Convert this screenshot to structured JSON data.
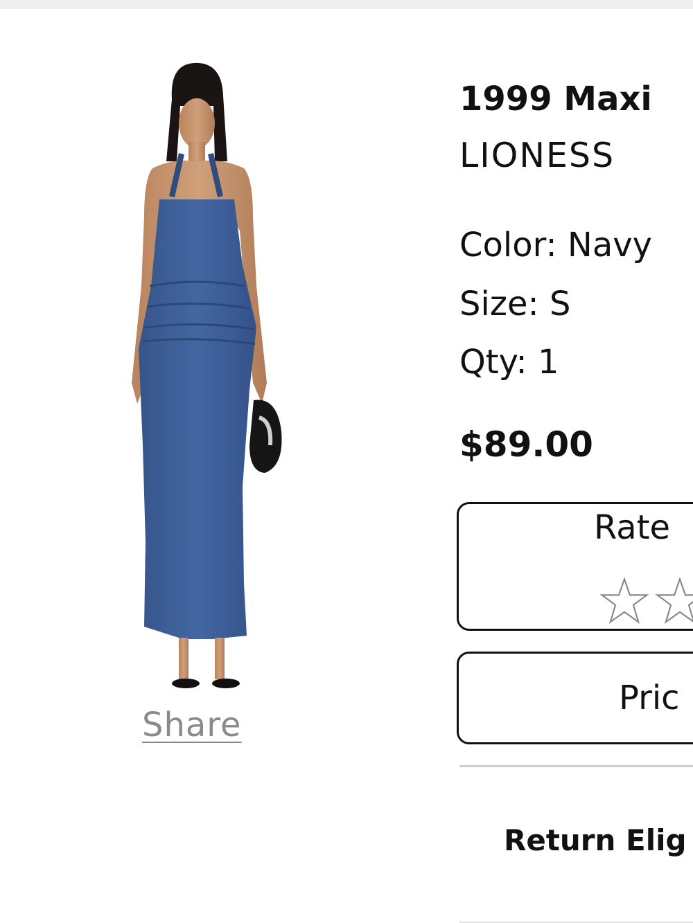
{
  "product": {
    "title": "1999 Maxi",
    "brand": "LIONESS",
    "color_text": "Color: Navy",
    "size_text": "Size: S",
    "qty_text": "Qty: 1",
    "price": "$89.00",
    "dress_color": "#3d5e96",
    "image_icon": "dress-model-image"
  },
  "actions": {
    "share_label": "Share",
    "rate_label": "Rate",
    "price_button_label": "Pric",
    "return_label": "Return Elig"
  },
  "rating": {
    "visible_stars": 2,
    "value": 0
  }
}
